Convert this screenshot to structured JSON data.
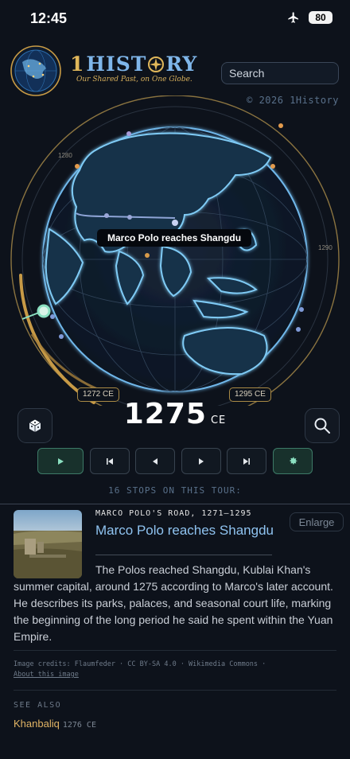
{
  "status_bar": {
    "time": "12:45",
    "battery": "80"
  },
  "header": {
    "brand_one": "1",
    "brand_rest_a": "HIST",
    "brand_rest_b": "RY",
    "tagline": "Our Shared Past, on One Globe.",
    "search_placeholder": "Search",
    "copyright": "© 2026 1History"
  },
  "globe": {
    "tooltip": "Marco Polo reaches Shangdu",
    "ring_label_left": "1280",
    "ring_label_right": "1290",
    "range_start": "1272 CE",
    "range_end": "1295 CE"
  },
  "timeline": {
    "year": "1275",
    "era": "CE",
    "stops_text": "16 STOPS ON THIS TOUR:"
  },
  "card": {
    "route_label": "MARCO POLO'S ROAD, 1271–1295",
    "title": "Marco Polo reaches Shangdu",
    "enlarge_label": "Enlarge",
    "description": "The Polos reached Shangdu, Kublai Khan's summer capital, around 1275 according to Marco's later account. He describes its parks, palaces, and seasonal court life, marking the beginning of the long period he said he spent within the Yuan Empire.",
    "credits": "Image credits: Flaumfeder · CC BY-SA 4.0 · Wikimedia Commons ·",
    "about_link": "About this image",
    "see_also_label": "SEE ALSO",
    "see_also_items": [
      {
        "name": "Khanbaliq",
        "year": "1276 CE"
      }
    ]
  },
  "colors": {
    "accent_blue": "#8fc3f0",
    "gold": "#e0b75a",
    "background": "#0d121b",
    "green": "#8be0c1"
  }
}
